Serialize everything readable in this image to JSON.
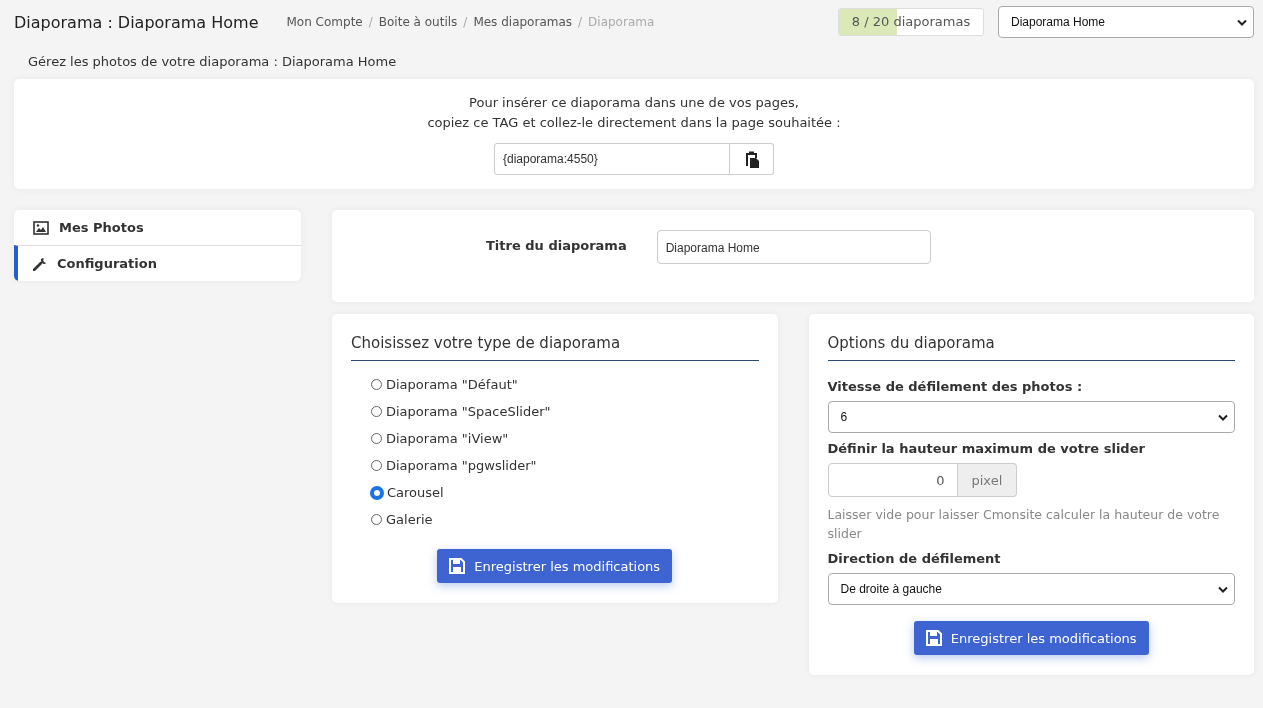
{
  "header": {
    "title": "Diaporama : Diaporama Home",
    "breadcrumb_separator": "/",
    "breadcrumb": [
      {
        "label": "Mon Compte",
        "current": false
      },
      {
        "label": "Boite à outils",
        "current": false
      },
      {
        "label": "Mes diaporamas",
        "current": false
      },
      {
        "label": "Diaporama",
        "current": true
      }
    ],
    "quota": {
      "text": "8 / 20 diaporamas",
      "level": 0.4
    },
    "diaporama_select": {
      "value": "Diaporama Home"
    }
  },
  "subtitle": "Gérez les photos de votre diaporama : Diaporama Home",
  "tag_card": {
    "lines": [
      "Pour insérer ce diaporama dans une de vos pages,",
      "copiez ce TAG et collez-le directement dans la page souhaitée :"
    ],
    "tag_value": "{diaporama:4550}"
  },
  "sidebar": {
    "items": [
      {
        "label": "Mes Photos",
        "kind": "photos",
        "selected": false
      },
      {
        "label": "Configuration",
        "kind": "config",
        "selected": true
      }
    ]
  },
  "title_card": {
    "label": "Titre du diaporama",
    "value": "Diaporama Home"
  },
  "type_card": {
    "heading": "Choisissez votre type de diaporama",
    "options": [
      {
        "label": "Diaporama \"Défaut\"",
        "selected": false
      },
      {
        "label": "Diaporama \"SpaceSlider\"",
        "selected": false
      },
      {
        "label": "Diaporama \"iView\"",
        "selected": false
      },
      {
        "label": "Diaporama \"pgwslider\"",
        "selected": false
      },
      {
        "label": "Carousel",
        "selected": true
      },
      {
        "label": "Galerie",
        "selected": false
      }
    ],
    "button": "Enregistrer les modifications"
  },
  "options_card": {
    "heading": "Options du diaporama",
    "speed_label": "Vitesse de défilement des photos :",
    "speed_value": "6",
    "height_label": "Définir la hauteur maximum de votre slider",
    "height_value": "0",
    "height_unit": "pixel",
    "height_help": "Laisser vide pour laisser Cmonsite calculer la hauteur de votre slider",
    "direction_label": "Direction de défilement",
    "direction_value": "De droite à gauche",
    "button": "Enregistrer les modifications"
  }
}
